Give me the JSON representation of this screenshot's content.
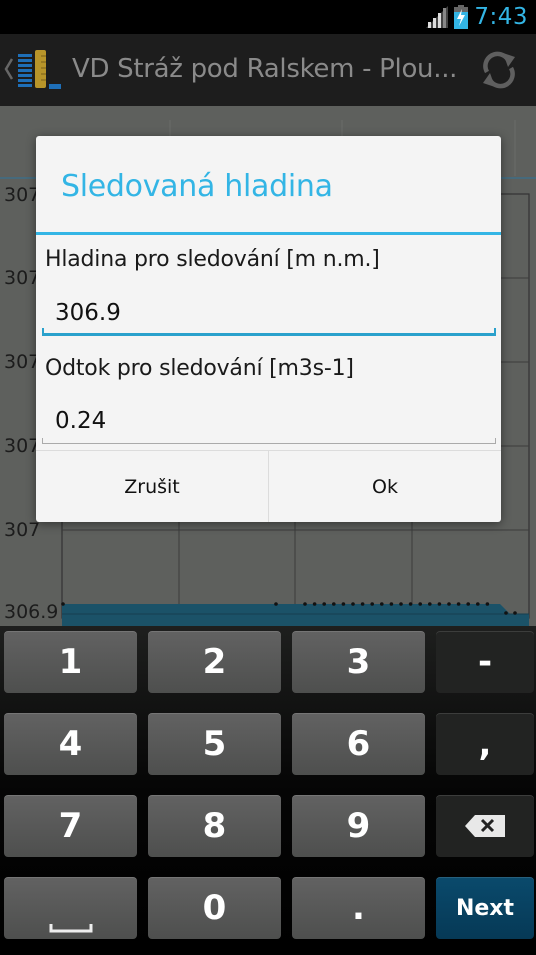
{
  "status_bar": {
    "time": "7:43",
    "icons": [
      "signal-icon",
      "battery-charging-icon"
    ]
  },
  "action_bar": {
    "title": "VD Stráž pod Ralskem - Plou...",
    "icons": [
      "back-chevron-icon",
      "app-logo-icon",
      "refresh-icon"
    ]
  },
  "background_chart": {
    "y_tick_labels": [
      "307",
      "307",
      "307",
      "307",
      "307",
      "306.9"
    ],
    "colors": {
      "area": "#1b5268",
      "gridline": "#3a3a3a",
      "points": "#111111"
    }
  },
  "dialog": {
    "title": "Sledovaná hladina",
    "fields": [
      {
        "label": "Hladina pro sledování [m n.m.]",
        "value": "306.9",
        "focused": true
      },
      {
        "label": "Odtok pro sledování [m3s-1]",
        "value": "0.24",
        "focused": false
      }
    ],
    "buttons": {
      "cancel": "Zrušit",
      "ok": "Ok"
    },
    "accent_color": "#33b5e5"
  },
  "keyboard": {
    "rows": [
      [
        "1",
        "2",
        "3",
        "-"
      ],
      [
        "4",
        "5",
        "6",
        ","
      ],
      [
        "7",
        "8",
        "9",
        "backspace"
      ],
      [
        "space",
        "0",
        ".",
        "Next"
      ]
    ],
    "labels": {
      "k1": "1",
      "k2": "2",
      "k3": "3",
      "minus": "-",
      "k4": "4",
      "k5": "5",
      "k6": "6",
      "comma": ",",
      "k7": "7",
      "k8": "8",
      "k9": "9",
      "k0": "0",
      "period": ".",
      "next": "Next"
    }
  }
}
